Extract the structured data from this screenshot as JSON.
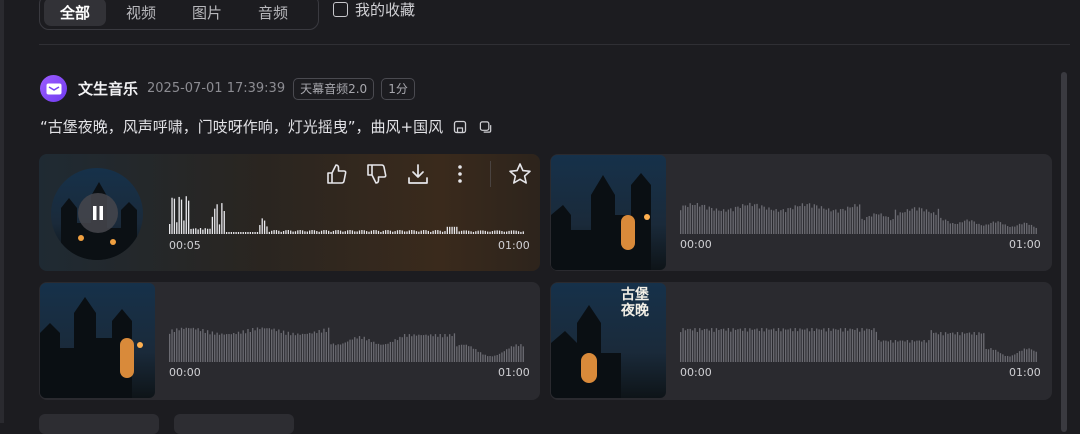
{
  "filters": {
    "tabs": [
      {
        "label": "全部",
        "active": true
      },
      {
        "label": "视频",
        "active": false
      },
      {
        "label": "图片",
        "active": false
      },
      {
        "label": "音频",
        "active": false
      }
    ],
    "favorites_label": "我的收藏"
  },
  "post": {
    "title": "文生音乐",
    "timestamp": "2025-07-01 17:39:39",
    "model_tag": "天幕音频2.0",
    "duration_tag": "1分",
    "prompt": "“古堡夜晚，风声呼啸，门吱呀作响，灯光摇曳”，曲风+国风"
  },
  "tracks": [
    {
      "start": "00:05",
      "end": "01:00",
      "state": "playing"
    },
    {
      "start": "00:00",
      "end": "01:00",
      "state": "idle"
    },
    {
      "start": "00:00",
      "end": "01:00",
      "state": "idle"
    },
    {
      "start": "00:00",
      "end": "01:00",
      "state": "idle",
      "cover_text": "古堡夜晚"
    }
  ],
  "icons": [
    "music-avatar-icon",
    "save-icon",
    "copy-icon",
    "thumbs-up-icon",
    "thumbs-down-icon",
    "download-icon",
    "more-icon",
    "star-icon",
    "pause-icon"
  ],
  "colors": {
    "background": "#1c1c20",
    "card": "#2a2a2f",
    "accent": "#8b4dff"
  }
}
